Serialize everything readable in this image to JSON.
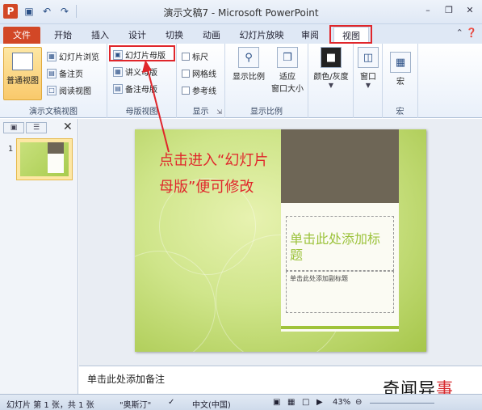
{
  "titlebar": {
    "app_icon": "P",
    "qat": {
      "save_icon": "save-icon",
      "undo_icon": "undo-icon",
      "redo_icon": "redo-icon"
    },
    "title": "演示文稿7 - Microsoft PowerPoint"
  },
  "tabs": {
    "file": "文件",
    "home": "开始",
    "insert": "插入",
    "design": "设计",
    "transitions": "切换",
    "animations": "动画",
    "slideshow": "幻灯片放映",
    "review": "审阅",
    "view": "视图"
  },
  "ribbon": {
    "presentation_views": {
      "normal": "普通视图",
      "slide_sorter": "幻灯片浏览",
      "notes_page": "备注页",
      "reading_view": "阅读视图",
      "label": "演示文稿视图"
    },
    "master_views": {
      "slide_master": "幻灯片母版",
      "handout_master": "讲义母版",
      "notes_master": "备注母版",
      "label": "母版视图"
    },
    "show": {
      "ruler": "标尺",
      "gridlines": "网格线",
      "guides": "参考线",
      "label": "显示"
    },
    "zoom": {
      "zoom": "显示比例",
      "fit_line1": "适应",
      "fit_line2": "窗口大小",
      "label": "显示比例"
    },
    "color": {
      "color_gray": "颜色/灰度"
    },
    "window": {
      "window": "窗口"
    },
    "macros": {
      "macro": "宏",
      "label": "宏"
    }
  },
  "slide_pane": {
    "slide_number": "1"
  },
  "slide": {
    "title_placeholder": "单击此处添加标题",
    "subtitle_placeholder": "单击此处添加副标题"
  },
  "annotation": {
    "text": "点击进入“幻灯片母版”便可修改",
    "color": "#e0262b"
  },
  "notes": {
    "placeholder": "单击此处添加备注"
  },
  "watermark": {
    "part1": "奇闻异",
    "part2": "事"
  },
  "statusbar": {
    "slide_info": "幻灯片 第 1 张，共 1 张",
    "theme": "\"奥斯汀\"",
    "language": "中文(中国)",
    "zoom": "43%"
  },
  "colors": {
    "file_tab": "#d24726",
    "highlight": "#e0262b",
    "slide_green": "#a6c64a"
  }
}
